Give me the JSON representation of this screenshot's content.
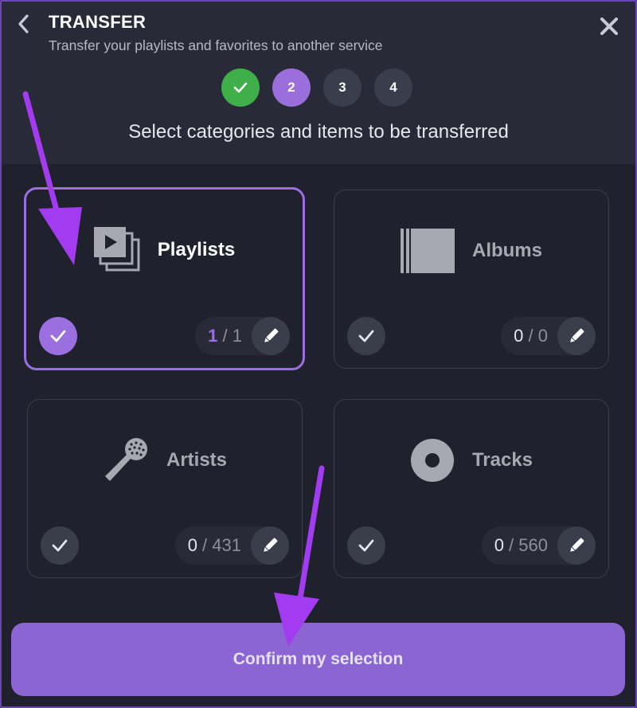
{
  "header": {
    "title": "TRANSFER",
    "subtitle": "Transfer your playlists and favorites to another service"
  },
  "steps": [
    {
      "label": "",
      "state": "done",
      "icon": "check-icon"
    },
    {
      "label": "2",
      "state": "active"
    },
    {
      "label": "3",
      "state": "pending"
    },
    {
      "label": "4",
      "state": "pending"
    }
  ],
  "instruction": "Select categories and items to be transferred",
  "categories": [
    {
      "label": "Playlists",
      "icon": "playlists-icon",
      "selected_count": "1",
      "total_sep": " / ",
      "total": "1",
      "is_selected": true
    },
    {
      "label": "Albums",
      "icon": "album-icon",
      "selected_count": "0",
      "total_sep": " / ",
      "total": "0",
      "is_selected": false
    },
    {
      "label": "Artists",
      "icon": "microphone-icon",
      "selected_count": "0",
      "total_sep": " / ",
      "total": "431",
      "is_selected": false
    },
    {
      "label": "Tracks",
      "icon": "disc-icon",
      "selected_count": "0",
      "total_sep": " / ",
      "total": "560",
      "is_selected": false
    }
  ],
  "confirm_label": "Confirm my selection",
  "colors": {
    "accent": "#9b6fe0",
    "done": "#3fb049",
    "background": "#1f222d",
    "annotation_arrow": "#a33cf0"
  }
}
